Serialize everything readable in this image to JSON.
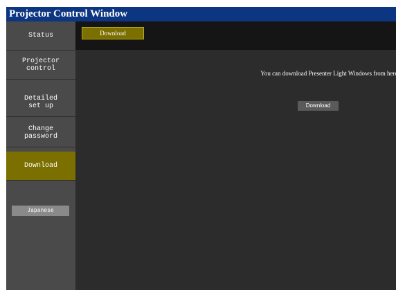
{
  "window": {
    "title": "Projector Control Window"
  },
  "sidebar": {
    "items": [
      {
        "label": "Status"
      },
      {
        "label": "Projector\ncontrol"
      },
      {
        "label": "Detailed\nset up"
      },
      {
        "label": "Change\npassword"
      },
      {
        "label": "Download",
        "active": true
      }
    ],
    "language_button": "Japanese"
  },
  "tabs": [
    {
      "label": "Download",
      "active": true
    }
  ],
  "content": {
    "message": "You can download Presenter Light Windows from here:",
    "download_button": "Download"
  },
  "colors": {
    "title_bar": "#0d3682",
    "sidebar": "#4a4a4a",
    "active": "#7b6f00",
    "content_bg": "#2c2c2c",
    "tab_strip": "#151515"
  }
}
